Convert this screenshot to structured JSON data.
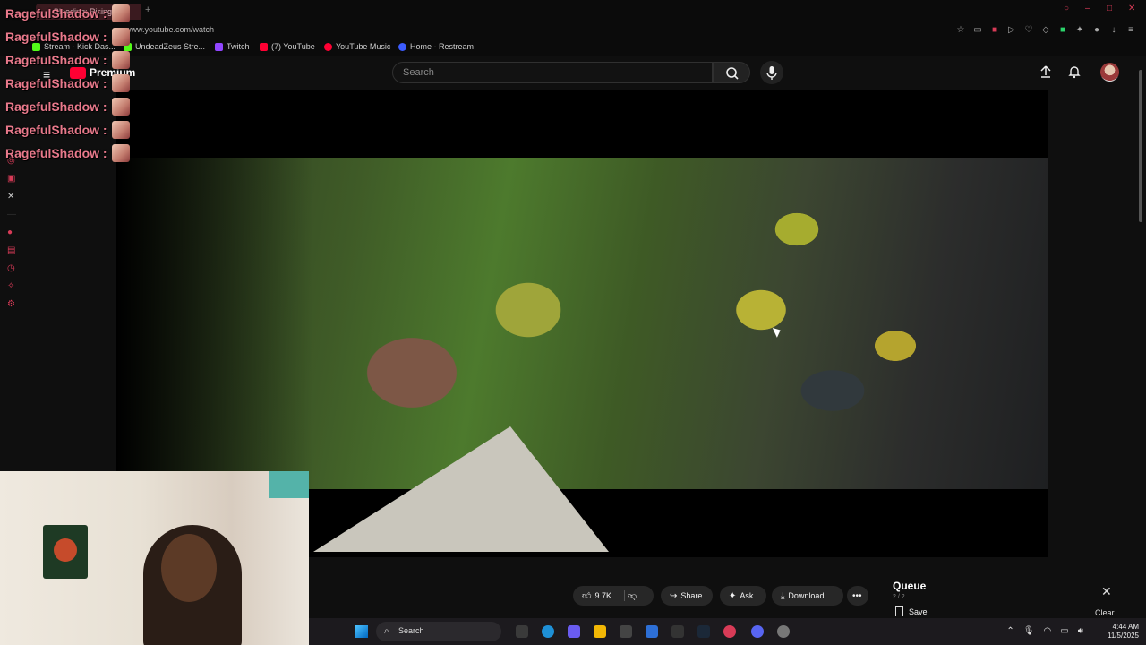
{
  "browser": {
    "active_tab": "Bleeding: Rising",
    "url": "www.youtube.com/watch",
    "bookmarks": [
      {
        "label": "Stream - Kick Das...",
        "color": "#53fc18"
      },
      {
        "label": "UndeadZeus Stre...",
        "color": "#53fc18"
      },
      {
        "label": "Twitch",
        "color": "#9146ff"
      },
      {
        "label": "(7) YouTube",
        "color": "#ff0033"
      },
      {
        "label": "YouTube Music",
        "color": "#ff0033"
      },
      {
        "label": "Home - Restream",
        "color": "#3c5cff"
      }
    ]
  },
  "youtube": {
    "logo_label": "Premium",
    "search_placeholder": "Search",
    "actions": {
      "like_count": "9.7K",
      "share_label": "Share",
      "ask_label": "Ask",
      "download_label": "Download"
    },
    "queue": {
      "title": "Queue",
      "count": "2 / 2",
      "save_label": "Save",
      "clear_label": "Clear"
    }
  },
  "chat": {
    "messages": [
      {
        "user": "RagefulShadow :"
      },
      {
        "user": "RagefulShadow :"
      },
      {
        "user": "RagefulShadow :"
      },
      {
        "user": "RagefulShadow :"
      },
      {
        "user": "RagefulShadow :"
      },
      {
        "user": "RagefulShadow :"
      },
      {
        "user": "RagefulShadow :"
      }
    ]
  },
  "taskbar": {
    "search_label": "Search",
    "time": "4:44 AM",
    "date": "11/5/2025"
  },
  "colors": {
    "accent": "#ff0033",
    "chat_name": "#e8798b",
    "browser_accent": "#d83b57"
  }
}
